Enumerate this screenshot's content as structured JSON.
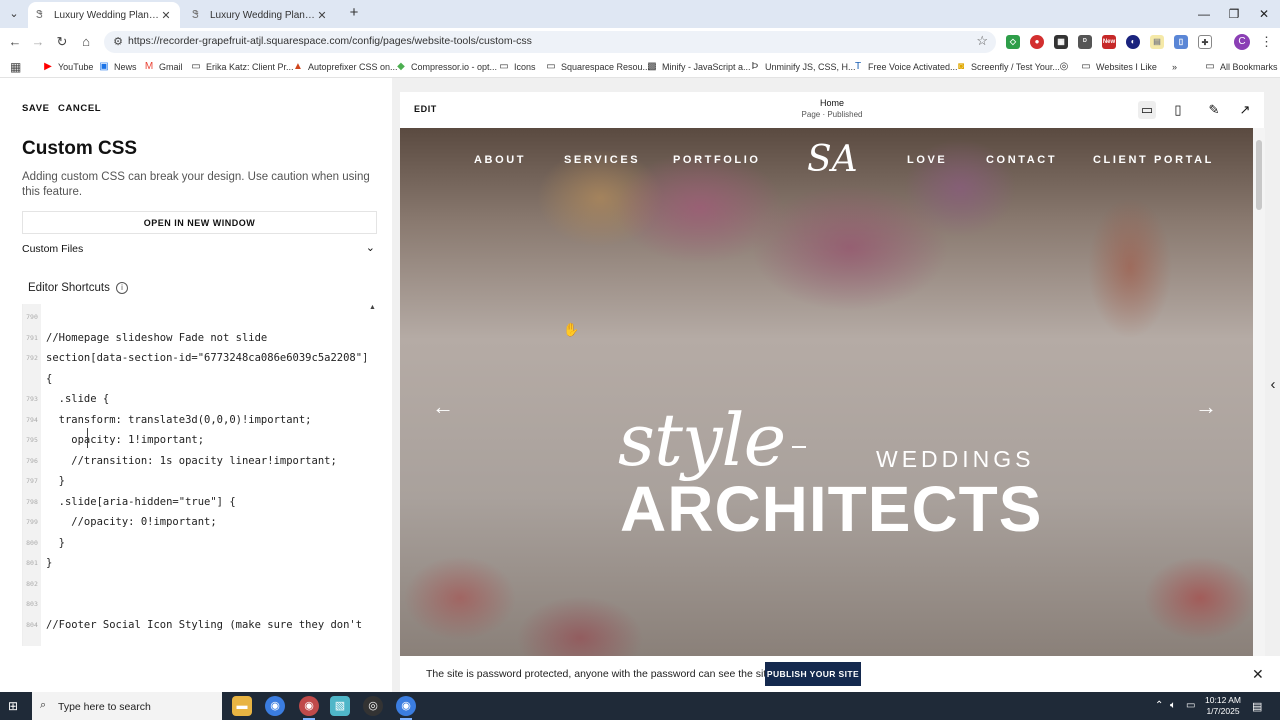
{
  "browser": {
    "tabs": [
      {
        "label": "Luxury Wedding Planning & Ev",
        "active": true
      },
      {
        "label": "Luxury Wedding Planning & Ev",
        "active": false
      }
    ],
    "url": "https://recorder-grapefruit-atjl.squarespace.com/config/pages/website-tools/custom-css",
    "profile_initial": "C",
    "extension_badge": "New"
  },
  "bookmarks": [
    {
      "label": "YouTube",
      "icon": "youtube-icon",
      "color": "#ff0000"
    },
    {
      "label": "News",
      "icon": "news-icon",
      "color": "#1a73e8"
    },
    {
      "label": "Gmail",
      "icon": "gmail-icon",
      "color": "#ea4335"
    },
    {
      "label": "Erika Katz: Client Pr...",
      "icon": "folder-icon",
      "color": "#444444"
    },
    {
      "label": "Autoprefixer CSS on...",
      "icon": "autoprefixer-icon",
      "color": "#d0461d"
    },
    {
      "label": "Compressor.io - opt...",
      "icon": "compressor-icon",
      "color": "#4caf50"
    },
    {
      "label": "Icons",
      "icon": "folder-icon",
      "color": "#444444"
    },
    {
      "label": "Squarespace Resou...",
      "icon": "folder-icon",
      "color": "#444444"
    },
    {
      "label": "Minify - JavaScript a...",
      "icon": "minify-icon",
      "color": "#333333"
    },
    {
      "label": "Unminify JS, CSS, H...",
      "icon": "unminify-icon",
      "color": "#333333"
    },
    {
      "label": "Free Voice Activated...",
      "icon": "voice-icon",
      "color": "#1a5fb4"
    },
    {
      "label": "Screenfly / Test Your...",
      "icon": "screenfly-icon",
      "color": "#e0a800"
    },
    {
      "label": "Websites I Like",
      "icon": "folder-icon",
      "color": "#444444"
    }
  ],
  "all_bookmarks": "All Bookmarks",
  "panel": {
    "save": "SAVE",
    "cancel": "CANCEL",
    "title": "Custom CSS",
    "description": "Adding custom CSS can break your design. Use caution when using this feature.",
    "open_window": "OPEN IN NEW WINDOW",
    "custom_files": "Custom Files",
    "editor_shortcuts": "Editor Shortcuts"
  },
  "code_lines": [
    {
      "n": "790",
      "text": ""
    },
    {
      "n": "791",
      "text": "//Homepage slideshow Fade not slide"
    },
    {
      "n": "792",
      "text": "section[data-section-id=\"6773248ca086e6039c5a2208\"]"
    },
    {
      "n": "",
      "text": "{"
    },
    {
      "n": "793",
      "text": "  .slide {"
    },
    {
      "n": "794",
      "text": "  transform: translate3d(0,0,0)!important;"
    },
    {
      "n": "795",
      "text": "    opacity: 1!important;"
    },
    {
      "n": "796",
      "text": "    //transition: 1s opacity linear!important;"
    },
    {
      "n": "797",
      "text": "  }"
    },
    {
      "n": "798",
      "text": "  .slide[aria-hidden=\"true\"] {"
    },
    {
      "n": "799",
      "text": "    //opacity: 0!important;"
    },
    {
      "n": "800",
      "text": "  }"
    },
    {
      "n": "801",
      "text": "}"
    },
    {
      "n": "802",
      "text": ""
    },
    {
      "n": "803",
      "text": ""
    },
    {
      "n": "804",
      "text": "//Footer Social Icon Styling (make sure they don't"
    }
  ],
  "preview": {
    "edit": "EDIT",
    "page_name": "Home",
    "page_status": "Page · Published",
    "nav_left": [
      "ABOUT",
      "SERVICES",
      "PORTFOLIO"
    ],
    "nav_right": [
      "LOVE",
      "CONTACT",
      "CLIENT PORTAL"
    ],
    "logo": "SA",
    "script_word": "style",
    "word_weddings": "WEDDINGS",
    "word_architects": "ARCHITECTS",
    "arrow_left": "←",
    "arrow_right": "→"
  },
  "banner": {
    "text": "The site is password protected, anyone with the password can see the site.",
    "button": "PUBLISH YOUR SITE"
  },
  "taskbar": {
    "search_placeholder": "Type here to search",
    "time": "10:12 AM",
    "date": "1/7/2025"
  }
}
